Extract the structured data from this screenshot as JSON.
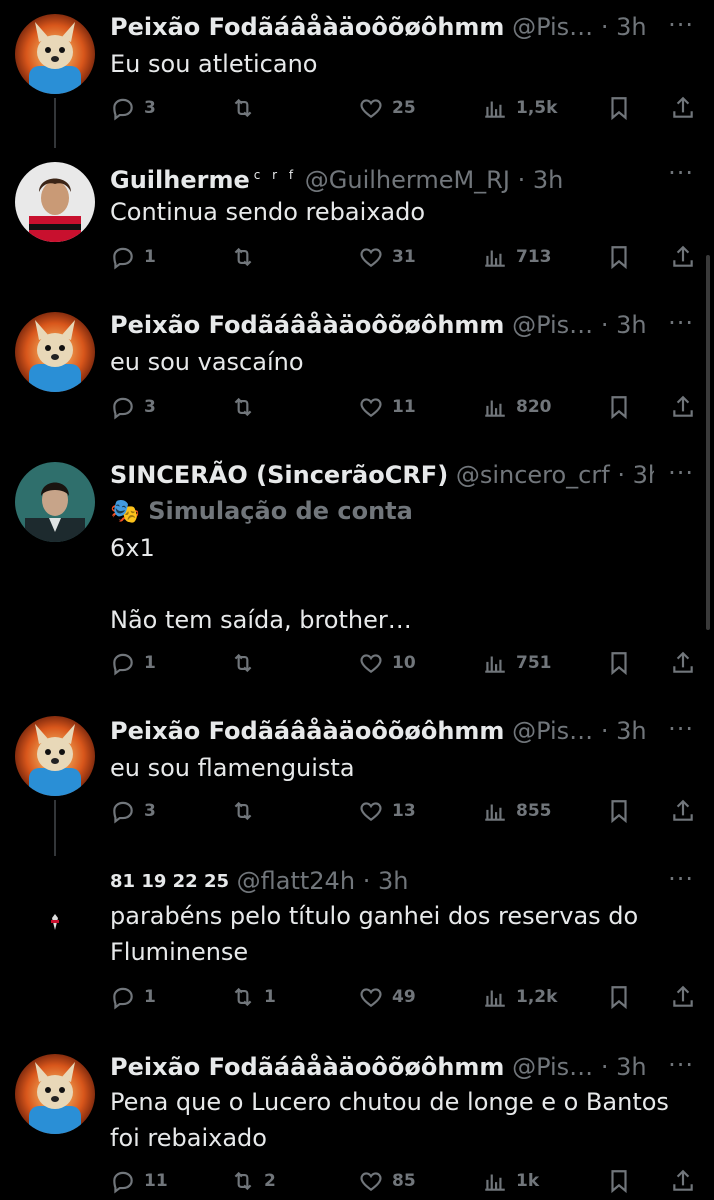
{
  "posts": [
    {
      "display_name": "Peixão Fodãáâåàäoôõøôhmm",
      "handle": "@Pis…",
      "time": "3h",
      "text": "Eu sou atleticano",
      "replies": "3",
      "retweets": "",
      "likes": "25",
      "views": "1,5k",
      "avatar": "dog-avatar"
    },
    {
      "display_name": "Guilherme",
      "name_suffix": "c r f",
      "handle": "@GuilhermeM_RJ",
      "time": "3h",
      "text": "Continua sendo rebaixado",
      "replies": "1",
      "retweets": "",
      "likes": "31",
      "views": "713",
      "avatar": "player-avatar"
    },
    {
      "display_name": "Peixão Fodãáâåàäoôõøôhmm",
      "handle": "@Pis…",
      "time": "3h",
      "text": "eu sou vascaíno",
      "replies": "3",
      "retweets": "",
      "likes": "11",
      "views": "820",
      "avatar": "dog-avatar"
    },
    {
      "display_name": "SINCERÃO (SincerãoCRF)",
      "handle": "@sincero_crf",
      "time": "3h",
      "label": "Simulação de conta",
      "text": "6x1\n\nNão tem saída, brother…",
      "replies": "1",
      "retweets": "",
      "likes": "10",
      "views": "751",
      "avatar": "man-avatar"
    },
    {
      "display_name": "Peixão Fodãáâåàäoôõøôhmm",
      "handle": "@Pis…",
      "time": "3h",
      "text": "eu sou flamenguista",
      "replies": "3",
      "retweets": "",
      "likes": "13",
      "views": "855",
      "avatar": "dog-avatar"
    },
    {
      "display_name": "81 19 22 25",
      "handle": "@flatt24h",
      "time": "3h",
      "text": "parabéns pelo título ganhei dos reservas do Fluminense",
      "replies": "1",
      "retweets": "1",
      "likes": "49",
      "views": "1,2k",
      "avatar": "crest-avatar"
    },
    {
      "display_name": "Peixão Fodãáâåàäoôõøôhmm",
      "handle": "@Pis…",
      "time": "3h",
      "text": "Pena que o Lucero chutou de longe e o Bantos foi rebaixado",
      "replies": "11",
      "retweets": "2",
      "likes": "85",
      "views": "1k",
      "avatar": "dog-avatar"
    }
  ],
  "ui": {
    "more_glyph": "···",
    "dot": "·"
  },
  "colors": {
    "background": "#000000",
    "text": "#e7e9ea",
    "muted": "#71767b"
  }
}
